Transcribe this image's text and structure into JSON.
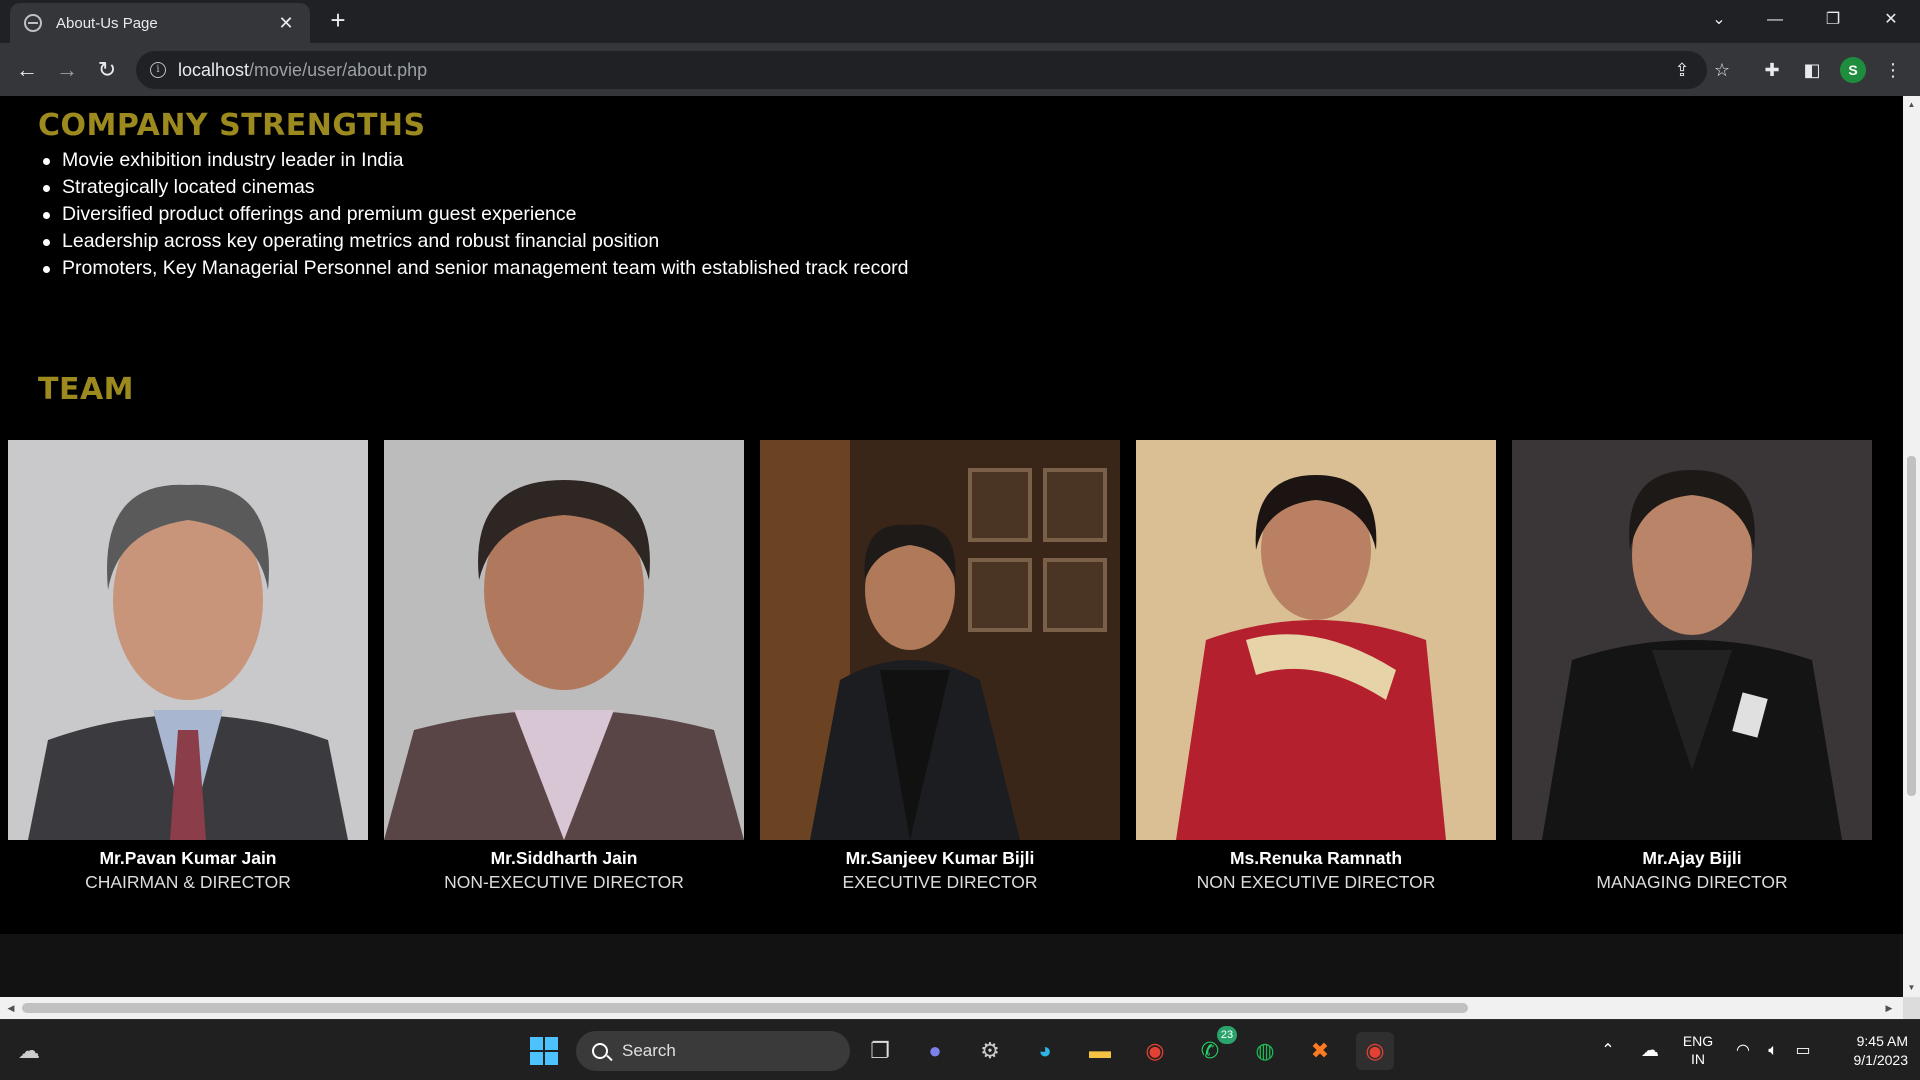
{
  "browser": {
    "tab_title": "About-Us Page",
    "tab_close": "✕",
    "new_tab": "+",
    "url_host": "localhost",
    "url_path": "/movie/user/about.php",
    "profile_initial": "S"
  },
  "page": {
    "strengths_title": "COMPANY STRENGTHS",
    "strengths": [
      "Movie exhibition industry leader in India",
      "Strategically located cinemas",
      "Diversified product offerings and premium guest experience",
      "Leadership across key operating metrics and robust financial position",
      "Promoters, Key Managerial Personnel and senior management team with established track record"
    ],
    "team_title": "TEAM",
    "team": [
      {
        "name": "Mr.Pavan Kumar Jain",
        "role": "CHAIRMAN & DIRECTOR"
      },
      {
        "name": "Mr.Siddharth Jain",
        "role": "NON-EXECUTIVE DIRECTOR"
      },
      {
        "name": "Mr.Sanjeev Kumar Bijli",
        "role": "EXECUTIVE DIRECTOR"
      },
      {
        "name": "Ms.Renuka Ramnath",
        "role": "NON EXECUTIVE DIRECTOR"
      },
      {
        "name": "Mr.Ajay Bijli",
        "role": "MANAGING DIRECTOR"
      }
    ]
  },
  "taskbar": {
    "search_label": "Search",
    "whatsapp_badge": "23",
    "lang_top": "ENG",
    "lang_bottom": "IN",
    "time": "9:45 AM",
    "date": "9/1/2023"
  },
  "colors": {
    "heading": "#9c8a1e",
    "page_bg": "#000000",
    "chrome_bg": "#35363a"
  }
}
